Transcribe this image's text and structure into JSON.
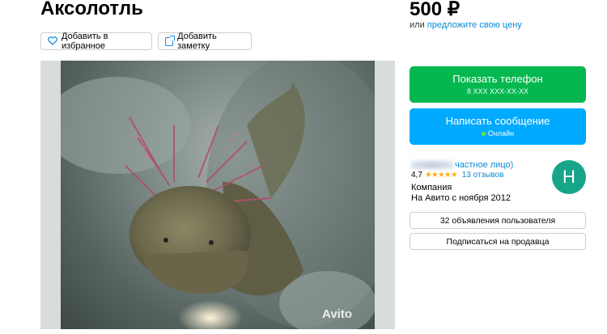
{
  "listing": {
    "title": "Аксолотль",
    "price": "500 ₽",
    "price_or": "или",
    "price_offer_link": "предложите свою цену"
  },
  "actions": {
    "favorite_label": "Добавить в избранное",
    "note_label": "Добавить заметку"
  },
  "photo": {
    "watermark": "Avito"
  },
  "contact": {
    "show_phone_label": "Показать телефон",
    "phone_masked": "8 XXX XXX-XX-XX",
    "message_label": "Написать сообщение",
    "online_status": "Онлайн"
  },
  "seller": {
    "name_suffix": "частное лицо)",
    "rating": "4,7",
    "stars": "★★★★★",
    "reviews": "13 отзывов",
    "type": "Компания",
    "since": "На Авито с ноября 2012",
    "avatar_letter": "Н",
    "avatar_color": "#17a589"
  },
  "seller_actions": {
    "ads_label": "32 объявления пользователя",
    "subscribe_label": "Подписаться на продавца"
  },
  "colors": {
    "green": "#04b84f",
    "blue": "#00aaff",
    "link": "#0a8bd6",
    "star": "#ffb021"
  }
}
